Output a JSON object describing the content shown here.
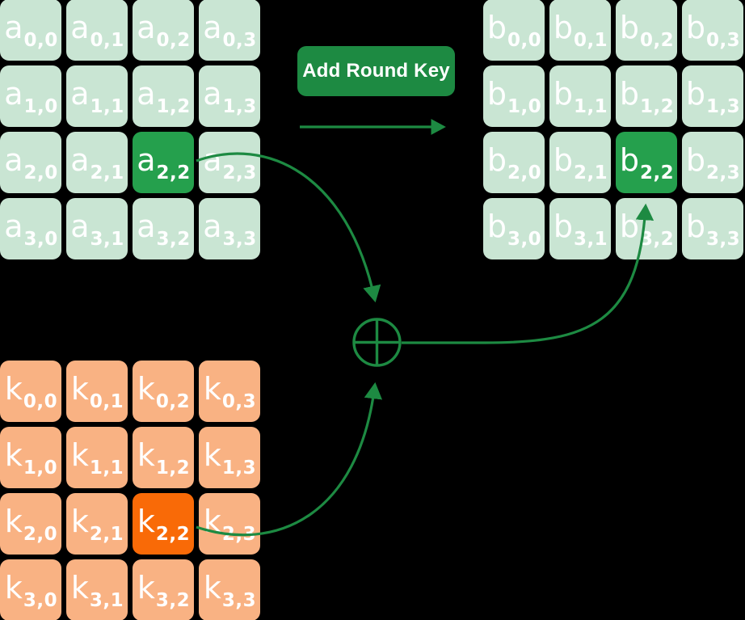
{
  "diagram": {
    "title": "AES Add Round Key step",
    "operation_label": "Add Round Key",
    "accent_green": "#1d8a42",
    "highlight_green": "#25a04d",
    "cell_green": "#c9e5d3",
    "highlight_orange": "#f96a07",
    "cell_orange": "#f9b283",
    "background": "#000000",
    "text_color": "#ffffff"
  },
  "state_in": {
    "name": "a",
    "highlight": "2,2",
    "cells": [
      {
        "base": "a",
        "sub": "0,0"
      },
      {
        "base": "a",
        "sub": "0,1"
      },
      {
        "base": "a",
        "sub": "0,2"
      },
      {
        "base": "a",
        "sub": "0,3"
      },
      {
        "base": "a",
        "sub": "1,0"
      },
      {
        "base": "a",
        "sub": "1,1"
      },
      {
        "base": "a",
        "sub": "1,2"
      },
      {
        "base": "a",
        "sub": "1,3"
      },
      {
        "base": "a",
        "sub": "2,0"
      },
      {
        "base": "a",
        "sub": "2,1"
      },
      {
        "base": "a",
        "sub": "2,2"
      },
      {
        "base": "a",
        "sub": "2,3"
      },
      {
        "base": "a",
        "sub": "3,0"
      },
      {
        "base": "a",
        "sub": "3,1"
      },
      {
        "base": "a",
        "sub": "3,2"
      },
      {
        "base": "a",
        "sub": "3,3"
      }
    ]
  },
  "state_out": {
    "name": "b",
    "highlight": "2,2",
    "cells": [
      {
        "base": "b",
        "sub": "0,0"
      },
      {
        "base": "b",
        "sub": "0,1"
      },
      {
        "base": "b",
        "sub": "0,2"
      },
      {
        "base": "b",
        "sub": "0,3"
      },
      {
        "base": "b",
        "sub": "1,0"
      },
      {
        "base": "b",
        "sub": "1,1"
      },
      {
        "base": "b",
        "sub": "1,2"
      },
      {
        "base": "b",
        "sub": "1,3"
      },
      {
        "base": "b",
        "sub": "2,0"
      },
      {
        "base": "b",
        "sub": "2,1"
      },
      {
        "base": "b",
        "sub": "2,2"
      },
      {
        "base": "b",
        "sub": "2,3"
      },
      {
        "base": "b",
        "sub": "3,0"
      },
      {
        "base": "b",
        "sub": "3,1"
      },
      {
        "base": "b",
        "sub": "3,2"
      },
      {
        "base": "b",
        "sub": "3,3"
      }
    ]
  },
  "round_key": {
    "name": "k",
    "highlight": "2,2",
    "cells": [
      {
        "base": "k",
        "sub": "0,0"
      },
      {
        "base": "k",
        "sub": "0,1"
      },
      {
        "base": "k",
        "sub": "0,2"
      },
      {
        "base": "k",
        "sub": "0,3"
      },
      {
        "base": "k",
        "sub": "1,0"
      },
      {
        "base": "k",
        "sub": "1,1"
      },
      {
        "base": "k",
        "sub": "1,2"
      },
      {
        "base": "k",
        "sub": "1,3"
      },
      {
        "base": "k",
        "sub": "2,0"
      },
      {
        "base": "k",
        "sub": "2,1"
      },
      {
        "base": "k",
        "sub": "2,2"
      },
      {
        "base": "k",
        "sub": "2,3"
      },
      {
        "base": "k",
        "sub": "3,0"
      },
      {
        "base": "k",
        "sub": "3,1"
      },
      {
        "base": "k",
        "sub": "3,2"
      },
      {
        "base": "k",
        "sub": "3,3"
      }
    ]
  },
  "xor": {
    "symbol": "xor-circle-plus"
  }
}
